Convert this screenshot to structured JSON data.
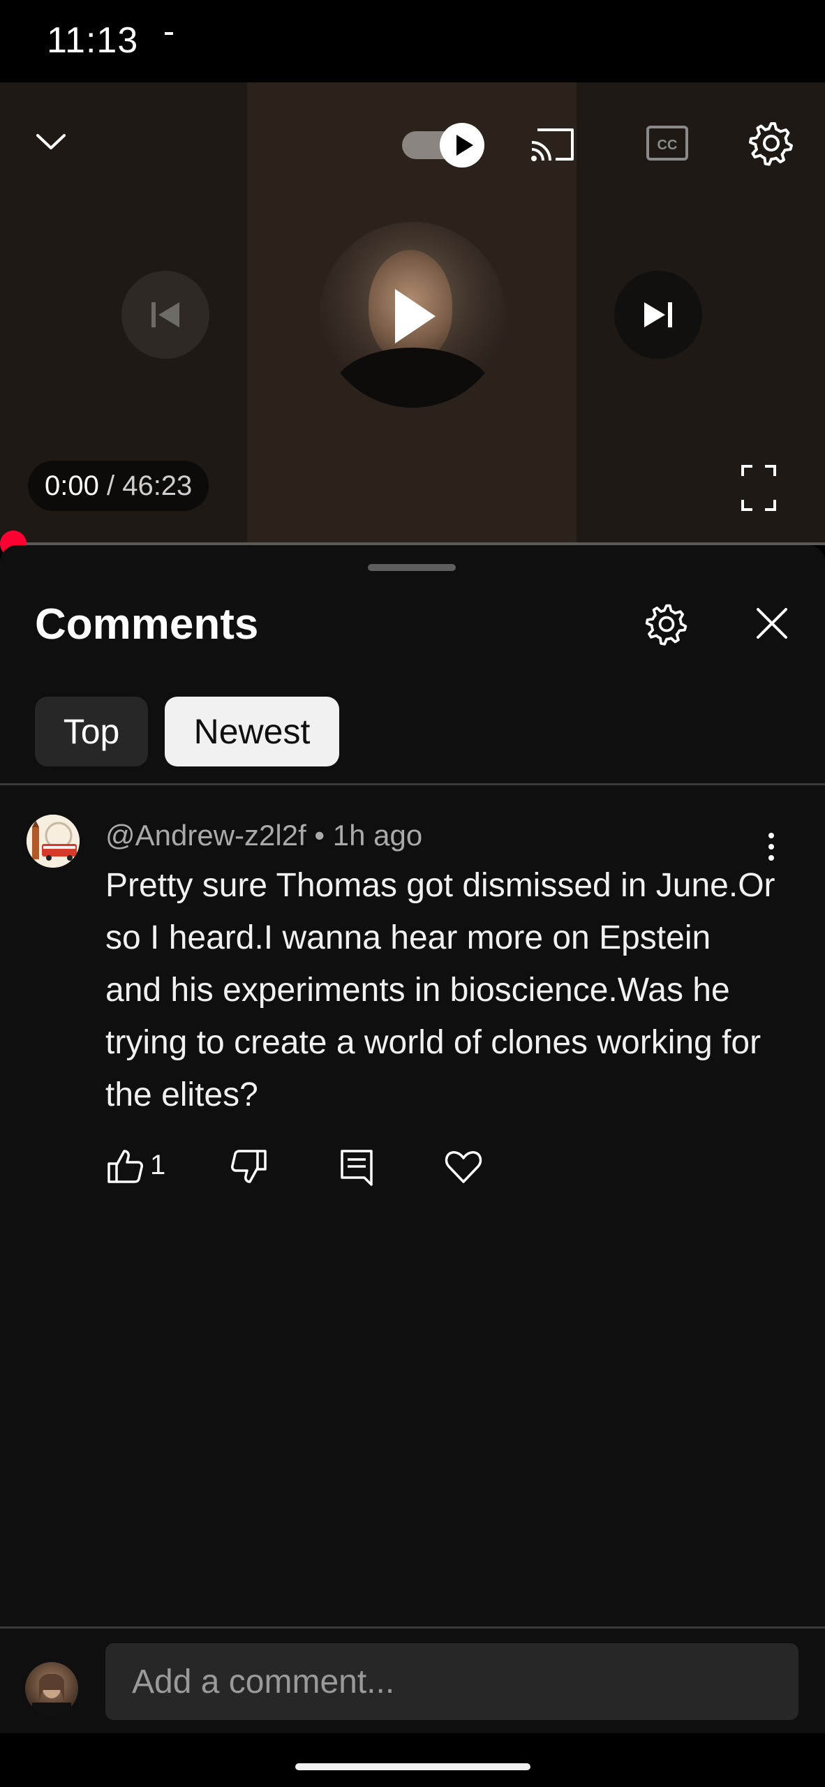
{
  "status_bar": {
    "time": "11:13"
  },
  "player": {
    "current_time": "0:00",
    "separator": " / ",
    "duration": "46:23",
    "progress": 0,
    "autoplay_on": true,
    "icons": {
      "minimize": "chevron-down-icon",
      "autoplay": "autoplay-toggle-icon",
      "cast": "cast-icon",
      "captions": "cc-icon",
      "settings": "gear-icon",
      "previous": "skip-previous-icon",
      "play": "play-icon",
      "next": "skip-next-icon",
      "fullscreen": "fullscreen-icon"
    },
    "accent_color": "#ff0033"
  },
  "comments_panel": {
    "title": "Comments",
    "filters": [
      {
        "label": "Top",
        "selected": false
      },
      {
        "label": "Newest",
        "selected": true
      }
    ],
    "comments": [
      {
        "author": "@Andrew-z2l2f",
        "separator": " • ",
        "time_ago": "1h ago",
        "text": "Pretty sure Thomas got dismissed in June.Or so I heard.I wanna hear more on Epstein and his experiments in bioscience.Was he trying to create a world of clones working for the elites?",
        "likes": "1"
      }
    ]
  },
  "composer": {
    "placeholder": "Add a comment..."
  }
}
